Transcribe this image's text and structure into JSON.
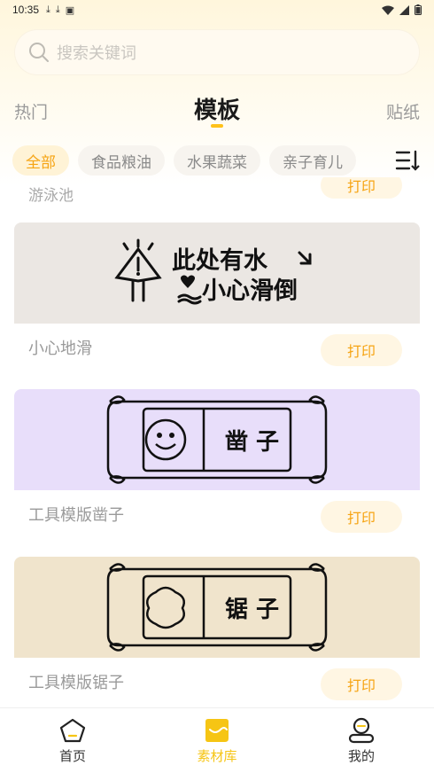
{
  "status": {
    "time": "10:35"
  },
  "search": {
    "placeholder": "搜索关键词"
  },
  "tabs": {
    "left": "热门",
    "center": "模板",
    "right": "贴纸"
  },
  "chips": [
    "全部",
    "食品粮油",
    "水果蔬菜",
    "亲子育儿"
  ],
  "partial": {
    "title": "游泳池",
    "button": "打印"
  },
  "cards": [
    {
      "title": "小心地滑",
      "button": "打印",
      "bg": "#ebe7e3",
      "line1": "此处有水",
      "line2": "小心滑倒"
    },
    {
      "title": "工具模版凿子",
      "button": "打印",
      "bg": "#e8defa",
      "label": "凿 子"
    },
    {
      "title": "工具模版锯子",
      "button": "打印",
      "bg": "#f0e4cc",
      "label": "锯 子"
    }
  ],
  "nav": {
    "home": "首页",
    "materials": "素材库",
    "mine": "我的"
  },
  "colors": {
    "accent": "#f6a413",
    "nav_active": "#f6c514"
  }
}
